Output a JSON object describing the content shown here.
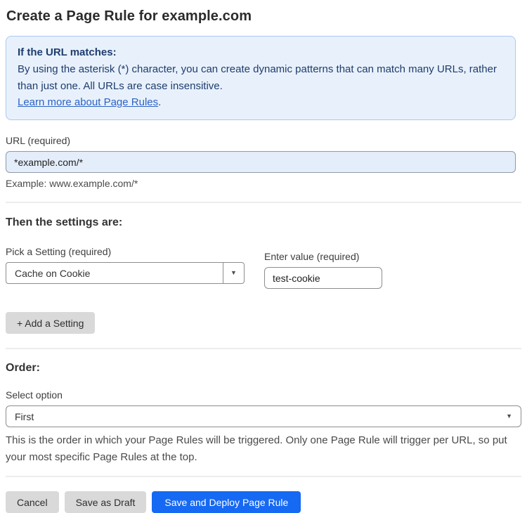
{
  "page": {
    "title": "Create a Page Rule for example.com"
  },
  "info_box": {
    "heading": "If the URL matches:",
    "body": "By using the asterisk (*) character, you can create dynamic patterns that can match many URLs, rather than just one. All URLs are case insensitive.",
    "link_label": "Learn more about Page Rules",
    "link_suffix": "."
  },
  "url_field": {
    "label": "URL (required)",
    "value": "*example.com/*",
    "example": "Example: www.example.com/*"
  },
  "settings_section": {
    "heading": "Then the settings are:",
    "setting_label": "Pick a Setting (required)",
    "setting_value": "Cache on Cookie",
    "setting_caret": "▼",
    "value_label": "Enter value (required)",
    "value_value": "test-cookie",
    "add_button_label": "+ Add a Setting"
  },
  "order_section": {
    "heading": "Order:",
    "select_label": "Select option",
    "select_value": "First",
    "select_caret": "▼",
    "help_text": "This is the order in which your Page Rules will be triggered. Only one Page Rule will trigger per URL, so put your most specific Page Rules at the top."
  },
  "actions": {
    "cancel_label": "Cancel",
    "save_draft_label": "Save as Draft",
    "deploy_label": "Save and Deploy Page Rule"
  },
  "colors": {
    "accent_blue": "#1669f2",
    "info_bg": "#e8f1fb",
    "info_border": "#abc9ee",
    "info_text": "#1e3c6e",
    "link_blue": "#2d62c4",
    "url_input_bg": "#e4eefb",
    "button_gray": "#d9d9d9"
  }
}
